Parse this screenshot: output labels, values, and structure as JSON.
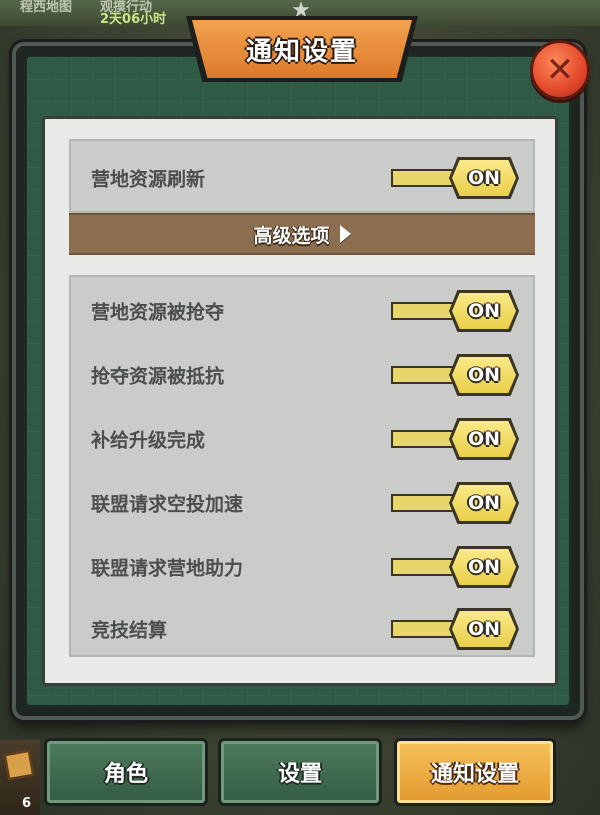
{
  "background": {
    "top_texts": [
      "程西地图",
      "观摸行动",
      "2天06小时"
    ]
  },
  "modal": {
    "title": "通知设置",
    "close_icon": "close-x-icon",
    "star_icon": "★"
  },
  "group_top": {
    "items": [
      {
        "label": "营地资源刷新",
        "state": "ON"
      }
    ]
  },
  "advanced": {
    "label": "高级选项"
  },
  "group_advanced": {
    "items": [
      {
        "label": "营地资源被抢夺",
        "state": "ON"
      },
      {
        "label": "抢夺资源被抵抗",
        "state": "ON"
      },
      {
        "label": "补给升级完成",
        "state": "ON"
      },
      {
        "label": "联盟请求空投加速",
        "state": "ON"
      },
      {
        "label": "联盟请求营地助力",
        "state": "ON"
      },
      {
        "label": "竞技结算",
        "state": "ON"
      }
    ]
  },
  "tabs": [
    {
      "label": "角色",
      "active": false
    },
    {
      "label": "设置",
      "active": false
    },
    {
      "label": "通知设置",
      "active": true
    }
  ],
  "side_badge": "6",
  "colors": {
    "accent_orange": "#dd7a2a",
    "toggle_yellow": "#e9cf4a",
    "panel_green": "#2f5a46",
    "advanced_bar": "#8b6e4f"
  }
}
